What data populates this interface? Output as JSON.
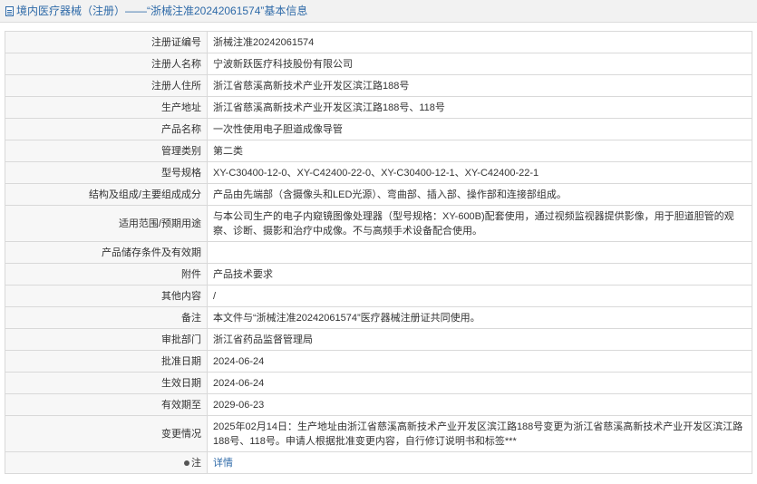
{
  "header": {
    "title": "境内医疗器械（注册）——“浙械注准20242061574”基本信息"
  },
  "rows": [
    {
      "label": "注册证编号",
      "value": "浙械注准20242061574"
    },
    {
      "label": "注册人名称",
      "value": "宁波新跃医疗科技股份有限公司"
    },
    {
      "label": "注册人住所",
      "value": "浙江省慈溪高新技术产业开发区滨江路188号"
    },
    {
      "label": "生产地址",
      "value": "浙江省慈溪高新技术产业开发区滨江路188号、118号"
    },
    {
      "label": "产品名称",
      "value": "一次性使用电子胆道成像导管"
    },
    {
      "label": "管理类别",
      "value": "第二类"
    },
    {
      "label": "型号规格",
      "value": "XY-C30400-12-0、XY-C42400-22-0、XY-C30400-12-1、XY-C42400-22-1"
    },
    {
      "label": "结构及组成/主要组成成分",
      "value": "产品由先端部（含摄像头和LED光源）、弯曲部、插入部、操作部和连接部组成。"
    },
    {
      "label": "适用范围/预期用途",
      "value": "与本公司生产的电子内窥镜图像处理器（型号规格：XY-600B)配套使用，通过视频监视器提供影像，用于胆道胆管的观察、诊断、摄影和治疗中成像。不与高频手术设备配合使用。"
    },
    {
      "label": "产品储存条件及有效期",
      "value": ""
    },
    {
      "label": "附件",
      "value": "产品技术要求"
    },
    {
      "label": "其他内容",
      "value": "/"
    },
    {
      "label": "备注",
      "value": "本文件与“浙械注准20242061574”医疗器械注册证共同使用。"
    },
    {
      "label": "审批部门",
      "value": "浙江省药品监督管理局"
    },
    {
      "label": "批准日期",
      "value": "2024-06-24"
    },
    {
      "label": "生效日期",
      "value": "2024-06-24"
    },
    {
      "label": "有效期至",
      "value": "2029-06-23"
    },
    {
      "label": "变更情况",
      "value": "2025年02月14日：生产地址由浙江省慈溪高新技术产业开发区滨江路188号变更为浙江省慈溪高新技术产业开发区滨江路188号、118号。申请人根据批准变更内容，自行修订说明书和标签***"
    }
  ],
  "note": {
    "label": "注",
    "link": "详情"
  }
}
